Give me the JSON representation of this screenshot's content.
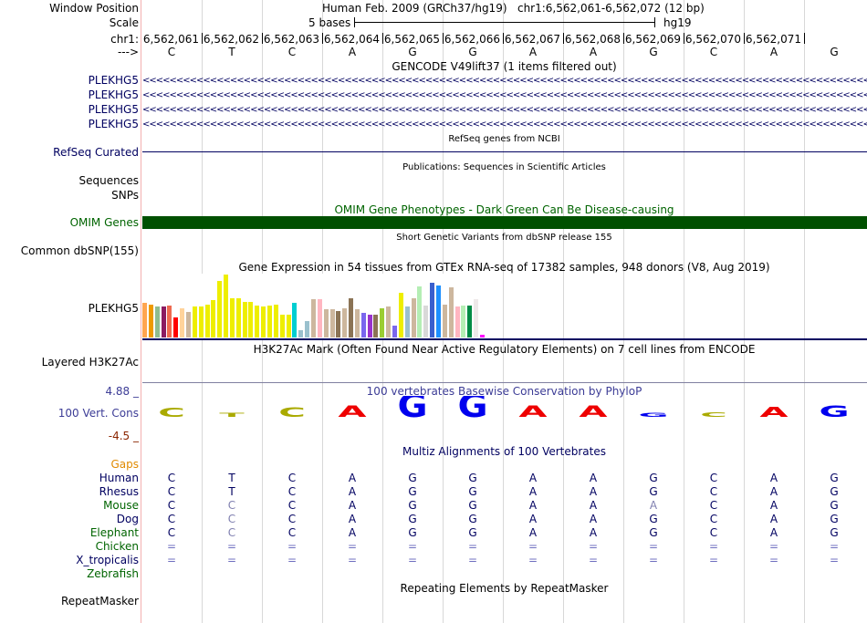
{
  "position": {
    "label": "Window Position",
    "assembly": "Human Feb. 2009 (GRCh37/hg19)",
    "region": "chr1:6,562,061-6,562,072 (12 bp)"
  },
  "scale": {
    "label": "Scale",
    "text": "5 bases",
    "db": "hg19"
  },
  "ruler": {
    "label": "chr1:",
    "ticks": [
      "6,562,061",
      "6,562,062",
      "6,562,063",
      "6,562,064",
      "6,562,065",
      "6,562,066",
      "6,562,067",
      "6,562,068",
      "6,562,069",
      "6,562,070",
      "6,562,071"
    ]
  },
  "bases": {
    "label": "--->",
    "seq": [
      "C",
      "T",
      "C",
      "A",
      "G",
      "G",
      "A",
      "A",
      "G",
      "C",
      "A",
      "G"
    ]
  },
  "gencode": {
    "title": "GENCODE V49lift37 (1 items filtered out)",
    "genes": [
      "PLEKHG5",
      "PLEKHG5",
      "PLEKHG5",
      "PLEKHG5"
    ],
    "strand_glyph": "<<<<<<<<<<<<<<<<<<<<<<<<<<<<<<<<<<<<<<<<<<<<<<<<<<<<<<<<<<<<<<<<<<<<<<<<<<<<<<<<<<<<<<<<<<<<<<<<<<<<<<<<<<<<<<<<<<<<<<<<<<<<<"
  },
  "refseq": {
    "title": "RefSeq genes from NCBI",
    "label": "RefSeq Curated"
  },
  "publications": {
    "title": "Publications: Sequences in Scientific Articles",
    "label1": "Sequences",
    "label2": "SNPs"
  },
  "omim": {
    "title": "OMIM Gene Phenotypes - Dark Green Can Be Disease-causing",
    "label": "OMIM Genes",
    "color": "#005000"
  },
  "dbsnp": {
    "title": "Short Genetic Variants from dbSNP release 155",
    "label": "Common dbSNP(155)"
  },
  "gtex": {
    "title": "Gene Expression in 54 tissues from GTEx RNA-seq of 17382 samples, 948 donors (V8, Aug 2019)",
    "label": "PLEKHG5",
    "bars": [
      {
        "v": 0.54,
        "c": "#FFA54F"
      },
      {
        "v": 0.52,
        "c": "#EE9A00"
      },
      {
        "v": 0.48,
        "c": "#8FBC8F"
      },
      {
        "v": 0.48,
        "c": "#8B1C62"
      },
      {
        "v": 0.5,
        "c": "#EE6A50"
      },
      {
        "v": 0.32,
        "c": "#FF0000"
      },
      {
        "v": 0.45,
        "c": "#FFD39B"
      },
      {
        "v": 0.4,
        "c": "#CDB79E"
      },
      {
        "v": 0.48,
        "c": "#EEEE00"
      },
      {
        "v": 0.48,
        "c": "#EEEE00"
      },
      {
        "v": 0.52,
        "c": "#EEEE00"
      },
      {
        "v": 0.58,
        "c": "#EEEE00"
      },
      {
        "v": 0.88,
        "c": "#EEEE00"
      },
      {
        "v": 0.98,
        "c": "#EEEE00"
      },
      {
        "v": 0.62,
        "c": "#EEEE00"
      },
      {
        "v": 0.62,
        "c": "#EEEE00"
      },
      {
        "v": 0.56,
        "c": "#EEEE00"
      },
      {
        "v": 0.56,
        "c": "#EEEE00"
      },
      {
        "v": 0.5,
        "c": "#EEEE00"
      },
      {
        "v": 0.48,
        "c": "#EEEE00"
      },
      {
        "v": 0.5,
        "c": "#EEEE00"
      },
      {
        "v": 0.52,
        "c": "#EEEE00"
      },
      {
        "v": 0.36,
        "c": "#EEEE00"
      },
      {
        "v": 0.36,
        "c": "#EEEE00"
      },
      {
        "v": 0.54,
        "c": "#00CED1"
      },
      {
        "v": 0.12,
        "c": "#9AC0CD"
      },
      {
        "v": 0.26,
        "c": "#9AC0CD"
      },
      {
        "v": 0.6,
        "c": "#CDB79E"
      },
      {
        "v": 0.6,
        "c": "#FFB6C1"
      },
      {
        "v": 0.44,
        "c": "#CDB79E"
      },
      {
        "v": 0.44,
        "c": "#CDB79E"
      },
      {
        "v": 0.42,
        "c": "#8B7355"
      },
      {
        "v": 0.46,
        "c": "#CDB79E"
      },
      {
        "v": 0.62,
        "c": "#8B7355"
      },
      {
        "v": 0.44,
        "c": "#CDB79E"
      },
      {
        "v": 0.38,
        "c": "#7A67EE"
      },
      {
        "v": 0.36,
        "c": "#9932CC"
      },
      {
        "v": 0.36,
        "c": "#8B7355"
      },
      {
        "v": 0.46,
        "c": "#9ACD32"
      },
      {
        "v": 0.48,
        "c": "#CDB79E"
      },
      {
        "v": 0.18,
        "c": "#7A67EE"
      },
      {
        "v": 0.7,
        "c": "#EEEE00"
      },
      {
        "v": 0.48,
        "c": "#9AC0CD"
      },
      {
        "v": 0.62,
        "c": "#CDB79E"
      },
      {
        "v": 0.8,
        "c": "#B4EEB4"
      },
      {
        "v": 0.5,
        "c": "#D9D9D9"
      },
      {
        "v": 0.86,
        "c": "#3A5FCD"
      },
      {
        "v": 0.82,
        "c": "#1E90FF"
      },
      {
        "v": 0.52,
        "c": "#CDB79E"
      },
      {
        "v": 0.78,
        "c": "#CDB79E"
      },
      {
        "v": 0.48,
        "c": "#FFB6C1"
      },
      {
        "v": 0.5,
        "c": "#B4EEB4"
      },
      {
        "v": 0.5,
        "c": "#008B45"
      },
      {
        "v": 0.6,
        "c": "#EEE9E9"
      },
      {
        "v": 0.04,
        "c": "#FF00FF"
      }
    ]
  },
  "h3k27": {
    "title": "H3K27Ac Mark (Often Found Near Active Regulatory Elements) on 7 cell lines from ENCODE",
    "label": "Layered H3K27Ac"
  },
  "phylop": {
    "title": "100 vertebrates Basewise Conservation by PhyloP",
    "label": "100 Vert. Cons",
    "max": "4.88 _",
    "min": "-4.5 _",
    "logo": [
      {
        "b": "C",
        "h": 0.38,
        "c": "#AAAA00"
      },
      {
        "b": "T",
        "h": 0.16,
        "c": "#AAAA00"
      },
      {
        "b": "C",
        "h": 0.4,
        "c": "#AAAA00"
      },
      {
        "b": "A",
        "h": 0.48,
        "c": "#EE0000"
      },
      {
        "b": "G",
        "h": 1.0,
        "c": "#0000EE"
      },
      {
        "b": "G",
        "h": 1.0,
        "c": "#0000EE"
      },
      {
        "b": "A",
        "h": 0.48,
        "c": "#EE0000"
      },
      {
        "b": "A",
        "h": 0.48,
        "c": "#EE0000"
      },
      {
        "b": "G",
        "h": 0.16,
        "c": "#0000EE"
      },
      {
        "b": "C",
        "h": 0.2,
        "c": "#AAAA00"
      },
      {
        "b": "A",
        "h": 0.42,
        "c": "#EE0000"
      },
      {
        "b": "G",
        "h": 0.48,
        "c": "#0000EE"
      }
    ]
  },
  "multiz": {
    "title": "Multiz Alignments of 100 Vertebrates",
    "gaps_label": "Gaps",
    "species": [
      {
        "name": "Human",
        "color": "#000060",
        "seq": [
          "C",
          "T",
          "C",
          "A",
          "G",
          "G",
          "A",
          "A",
          "G",
          "C",
          "A",
          "G"
        ]
      },
      {
        "name": "Rhesus",
        "color": "#000060",
        "seq": [
          "C",
          "T",
          "C",
          "A",
          "G",
          "G",
          "A",
          "A",
          "G",
          "C",
          "A",
          "G"
        ]
      },
      {
        "name": "Mouse",
        "color": "#006400",
        "seq": [
          "C",
          "C",
          "C",
          "A",
          "G",
          "G",
          "A",
          "A",
          "A",
          "C",
          "A",
          "G"
        ]
      },
      {
        "name": "Dog",
        "color": "#000060",
        "seq": [
          "C",
          "C",
          "C",
          "A",
          "G",
          "G",
          "A",
          "A",
          "G",
          "C",
          "A",
          "G"
        ]
      },
      {
        "name": "Elephant",
        "color": "#006400",
        "seq": [
          "C",
          "C",
          "C",
          "A",
          "G",
          "G",
          "A",
          "A",
          "G",
          "C",
          "A",
          "G"
        ]
      },
      {
        "name": "Chicken",
        "color": "#006400",
        "seq": [
          "=",
          "=",
          "=",
          "=",
          "=",
          "=",
          "=",
          "=",
          "=",
          "=",
          "=",
          "="
        ]
      },
      {
        "name": "X_tropicalis",
        "color": "#000060",
        "seq": [
          "=",
          "=",
          "=",
          "=",
          "=",
          "=",
          "=",
          "=",
          "=",
          "=",
          "=",
          "="
        ]
      },
      {
        "name": "Zebrafish",
        "color": "#006400",
        "seq": []
      }
    ]
  },
  "repeatmasker": {
    "title": "Repeating Elements by RepeatMasker",
    "label": "RepeatMasker"
  }
}
